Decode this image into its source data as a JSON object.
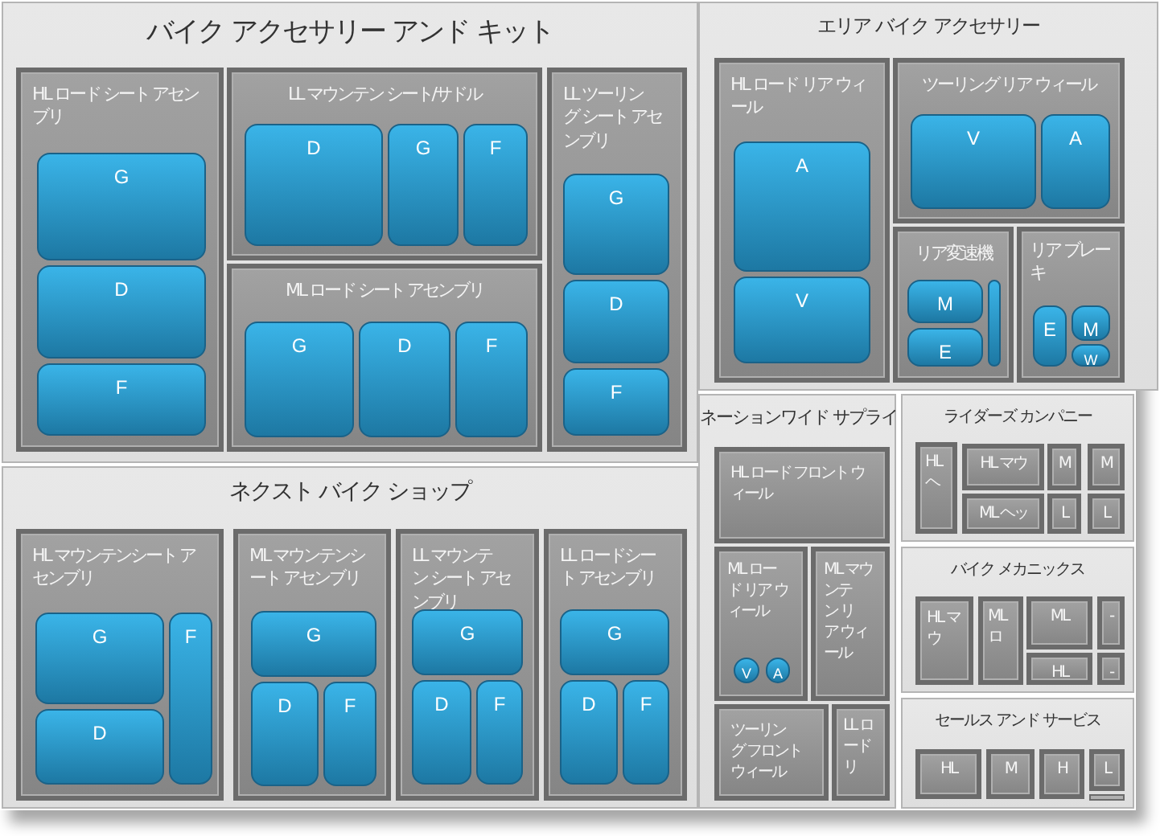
{
  "groups": [
    {
      "title": "バイク アクセサリー アンド キット",
      "items": [
        {
          "label": "HL ロード シート アセンブリ",
          "leaves": [
            {
              "label": "G"
            },
            {
              "label": "D"
            },
            {
              "label": "F"
            }
          ]
        },
        {
          "label": "LL マウンテン シート/サドル",
          "leaves": [
            {
              "label": "D"
            },
            {
              "label": "G"
            },
            {
              "label": "F"
            }
          ]
        },
        {
          "label": "ML ロード シート アセンブリ",
          "leaves": [
            {
              "label": "G"
            },
            {
              "label": "D"
            },
            {
              "label": "F"
            }
          ]
        },
        {
          "label": "LL ツーリング シート アセンブリ",
          "leaves": [
            {
              "label": "G"
            },
            {
              "label": "D"
            },
            {
              "label": "F"
            }
          ]
        }
      ]
    },
    {
      "title": "ネクスト バイク ショップ",
      "items": [
        {
          "label": "HL マウンテンシート アセンブリ",
          "leaves": [
            {
              "label": "G"
            },
            {
              "label": "D"
            },
            {
              "label": "F"
            }
          ]
        },
        {
          "label": "ML マウンテンシート アセンブリ",
          "leaves": [
            {
              "label": "G"
            },
            {
              "label": "D"
            },
            {
              "label": "F"
            }
          ]
        },
        {
          "label": "LL マウンテン シート アセンブリ",
          "leaves": [
            {
              "label": "G"
            },
            {
              "label": "D"
            },
            {
              "label": "F"
            }
          ]
        },
        {
          "label": "LL ロードシート アセンブリ",
          "leaves": [
            {
              "label": "G"
            },
            {
              "label": "D"
            },
            {
              "label": "F"
            }
          ]
        }
      ]
    },
    {
      "title": "エリア バイク アクセサリー",
      "items": [
        {
          "label": "HL ロード リア ウィール",
          "leaves": [
            {
              "label": "A"
            },
            {
              "label": "V"
            }
          ]
        },
        {
          "label": "ツーリング リア ウィール",
          "leaves": [
            {
              "label": "V"
            },
            {
              "label": "A"
            }
          ]
        },
        {
          "label": "リア変速機",
          "leaves": [
            {
              "kind": "tile",
              "label": "M"
            },
            {
              "kind": "tile",
              "label": "E"
            },
            {
              "kind": "blank"
            }
          ]
        },
        {
          "label": "リア ブレーキ",
          "leaves": [
            {
              "label": "E"
            },
            {
              "label": "M"
            },
            {
              "label": "W"
            }
          ]
        }
      ]
    },
    {
      "title": "ネーションワイド サプライ",
      "items": [
        {
          "label": "HL ロード フロント ウィール"
        },
        {
          "label": "ML ロード リア ウィール",
          "leaves": [
            {
              "label": "V"
            },
            {
              "label": "A"
            }
          ]
        },
        {
          "label": "ML マウンテン リア ウィール"
        },
        {
          "label": "ツーリング フロントウィール"
        },
        {
          "label": "LL ロードリ"
        }
      ]
    },
    {
      "title": "ライダーズ カンパニー",
      "items": [
        {
          "label": "HLヘ"
        },
        {
          "label": "HL マウ"
        },
        {
          "label": "M"
        },
        {
          "label": "M"
        },
        {
          "label": "ML ヘッ"
        },
        {
          "label": "L"
        },
        {
          "label": "L"
        }
      ]
    },
    {
      "title": "バイク メカニックス",
      "items": [
        {
          "label": "HL マウ"
        },
        {
          "label": "MLロ"
        },
        {
          "label": "ML"
        },
        {
          "label": "-"
        },
        {
          "label": "HL"
        },
        {
          "label": "-"
        }
      ]
    },
    {
      "title": "セールス アンド サービス",
      "items": [
        {
          "kind": "tile",
          "label": "HL"
        },
        {
          "kind": "tile",
          "label": "M"
        },
        {
          "kind": "tile",
          "label": "H"
        },
        {
          "kind": "tile",
          "label": "L"
        },
        {
          "kind": "blank"
        }
      ]
    }
  ]
}
